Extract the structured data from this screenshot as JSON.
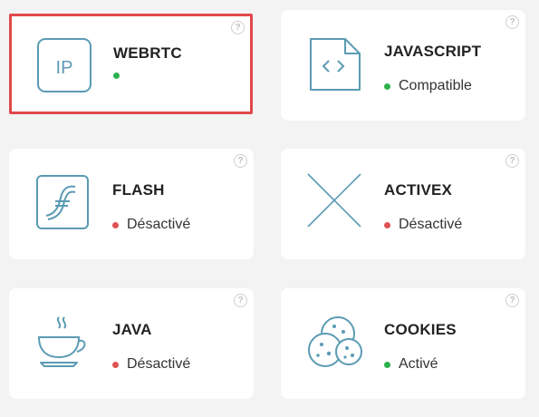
{
  "cards": [
    {
      "title": "WEBRTC",
      "status": "",
      "status_color": "#2ab24c",
      "icon": "ip-icon"
    },
    {
      "title": "JAVASCRIPT",
      "status": "Compatible",
      "status_color": "#2ab24c",
      "icon": "code-file-icon"
    },
    {
      "title": "FLASH",
      "status": "Désactivé",
      "status_color": "#e05252",
      "icon": "flash-icon"
    },
    {
      "title": "ACTIVEX",
      "status": "Désactivé",
      "status_color": "#e05252",
      "icon": "cross-icon"
    },
    {
      "title": "JAVA",
      "status": "Désactivé",
      "status_color": "#e05252",
      "icon": "coffee-cup-icon"
    },
    {
      "title": "COOKIES",
      "status": "Activé",
      "status_color": "#2ab24c",
      "icon": "cookies-icon"
    }
  ],
  "ip_icon_label": "IP",
  "help_glyph": "?"
}
